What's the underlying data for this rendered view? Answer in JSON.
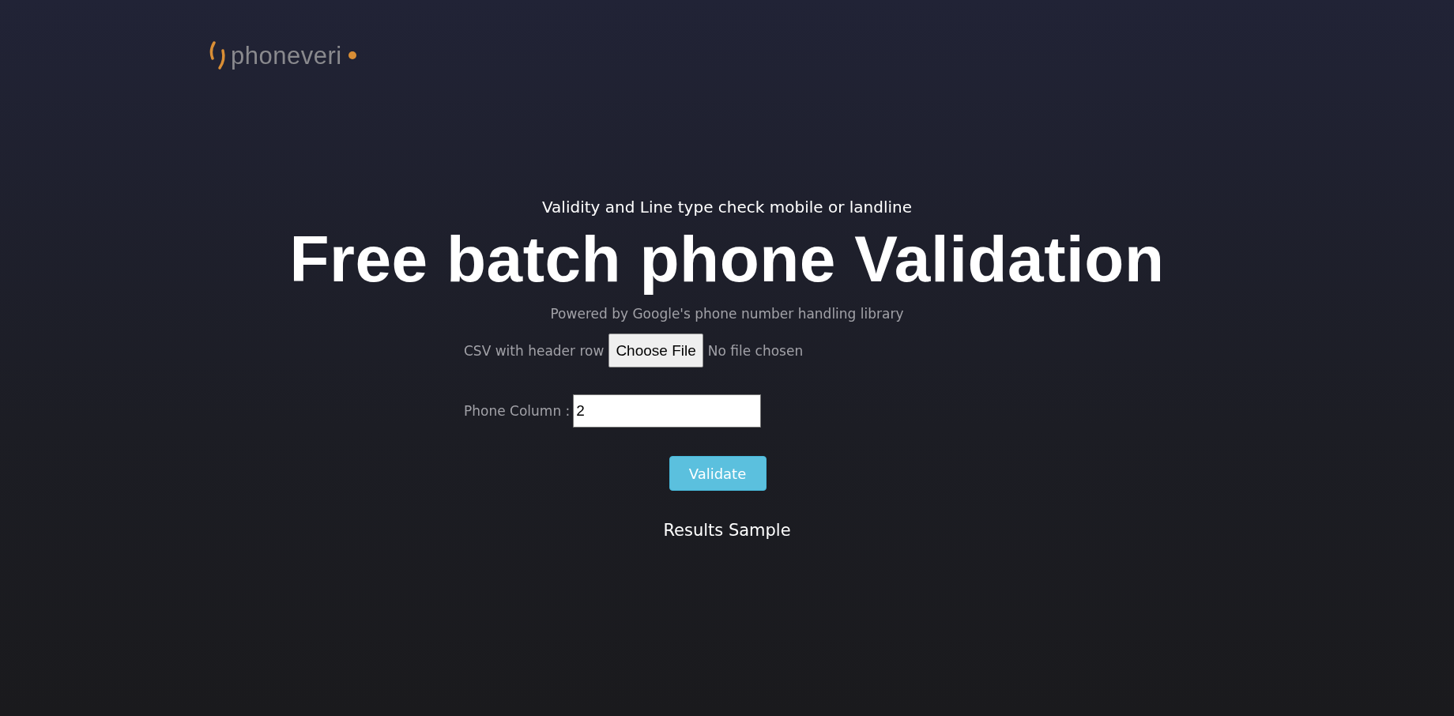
{
  "logo": {
    "text": "phoneveri"
  },
  "subtitle": "Validity and Line type check mobile or landline",
  "heading": "Free batch phone Validation",
  "tagline": "Powered by Google's phone number handling library",
  "file_upload": {
    "label": "CSV with header row",
    "button": "Choose File",
    "status": "No file chosen"
  },
  "phone_column": {
    "label": "Phone Column :",
    "value": "2"
  },
  "validate_button": "Validate",
  "results_heading": "Results Sample"
}
